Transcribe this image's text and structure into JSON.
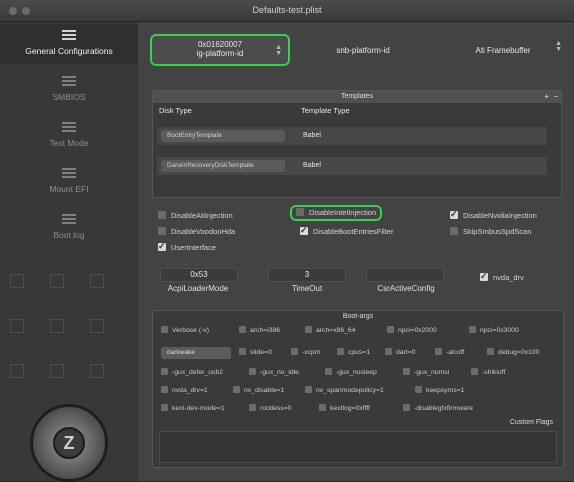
{
  "window": {
    "title": "Defaults-test.plist"
  },
  "sidebar": {
    "items": [
      {
        "label": "General Configurations",
        "icon": "list-icon",
        "active": true
      },
      {
        "label": "SMBIOS",
        "icon": "list-icon",
        "active": false
      },
      {
        "label": "Text Mode",
        "icon": "list-icon",
        "active": false
      },
      {
        "label": "Mount EFI",
        "icon": "list-icon",
        "active": false
      },
      {
        "label": "Boot.log",
        "icon": "list-icon",
        "active": false
      }
    ],
    "logo_letter": "Z"
  },
  "popups": {
    "ig_platform": {
      "value": "0x01620007",
      "label": "ig-platform-id"
    },
    "snb_platform": {
      "label": "snb-platform-id"
    },
    "ati_framebuffer": {
      "label": "Ati Framebuffer"
    }
  },
  "templates": {
    "title": "Templates",
    "add": "+",
    "remove": "−",
    "columns": [
      "Disk Type",
      "Template Type"
    ],
    "rows": [
      {
        "disk_type": "BootEntryTemplate",
        "template_type": "Babel"
      },
      {
        "disk_type": "DarwinRecoveryDiskTemplate",
        "template_type": "Babel"
      }
    ]
  },
  "checkboxes": {
    "disable_ati_injection": {
      "label": "DisableAtiInjection",
      "checked": false
    },
    "disable_intel_injection": {
      "label": "DisableIntelInjection",
      "checked": false
    },
    "disable_nvidia_injection": {
      "label": "DisableNvidiaInjection",
      "checked": true
    },
    "disable_voodoo_hda": {
      "label": "DisableVoodooHda",
      "checked": false
    },
    "disable_boot_entries_filter": {
      "label": "DisableBootEntriesFilter",
      "checked": true
    },
    "skip_smbus_spd_scan": {
      "label": "SkipSmbusSpdScan",
      "checked": false
    },
    "user_interface": {
      "label": "UserInterface",
      "checked": true
    },
    "nvda_drv": {
      "label": "nvda_drv",
      "checked": true
    }
  },
  "fields": {
    "acpi_loader_mode": {
      "value": "0x53",
      "label": "AcpiLoaderMode"
    },
    "timeout": {
      "value": "3",
      "label": "TimeOut"
    },
    "csr_active_config": {
      "value": "",
      "label": "CsrActiveConfig"
    }
  },
  "boot_args": {
    "title": "Boot-args",
    "row1": [
      "Verbose (-v)",
      "arch=i386",
      "arch=x86_64",
      "npci=0x2000",
      "npci=0x3000"
    ],
    "select": "darkwake",
    "row2": [
      "slide=0",
      "-xcpm",
      "cpus=1",
      "dart=0",
      "-alcoff",
      "debug=0x100"
    ],
    "row3": [
      "-gux_defer_usb2",
      "-gux_no_idle",
      "-gux_nosleep",
      "-gux_nomsi",
      "-shikioff"
    ],
    "row4": [
      "nvda_drv=1",
      "nv_disable=1",
      "nv_spanmodepolicy=1",
      "keepsyms=1"
    ],
    "row5": [
      "kext-dev-mode=1",
      "rootless=0",
      "kextlog=0xffff",
      "-disablegfxfirmware"
    ],
    "custom_flags_label": "Custom Flags"
  },
  "colors": {
    "highlight": "#33d14c",
    "bg": "#434343",
    "sidebar": "#383838"
  }
}
